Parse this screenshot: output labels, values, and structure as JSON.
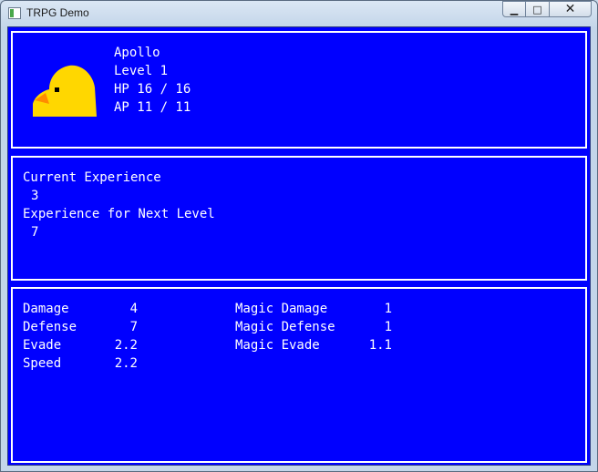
{
  "window": {
    "title": "TRPG Demo",
    "minimize_glyph": "▁",
    "maximize_glyph": "□",
    "close_glyph": "✕"
  },
  "character": {
    "name": "Apollo",
    "level": "Level 1",
    "hp": "HP 16 / 16",
    "ap": "AP 11 / 11",
    "portrait": "yellow-chick-icon"
  },
  "experience": {
    "current_label": "Current Experience",
    "current_value": "3",
    "next_label": "Experience for Next Level",
    "next_value": "7"
  },
  "stats": {
    "left": [
      {
        "label": "Damage",
        "value": "4"
      },
      {
        "label": "Defense",
        "value": "7"
      },
      {
        "label": "Evade",
        "value": "2.2"
      },
      {
        "label": "Speed",
        "value": "2.2"
      }
    ],
    "right": [
      {
        "label": "Magic Damage",
        "value": "1"
      },
      {
        "label": "Magic Defense",
        "value": "1"
      },
      {
        "label": "Magic Evade",
        "value": "1.1"
      }
    ]
  },
  "colors": {
    "panel_bg": "#0000ff",
    "panel_border": "#ffffff",
    "text": "#ffffff",
    "chick_body": "#ffd700",
    "chick_beak": "#ff8c00"
  }
}
